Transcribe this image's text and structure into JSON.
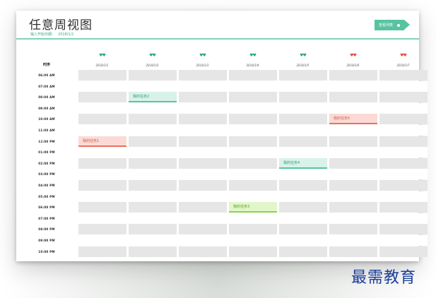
{
  "title": "任意周视图",
  "subtitle": {
    "label": "输入开始日期：",
    "value": "2018/1/1"
  },
  "task_button": {
    "label": "查看列表"
  },
  "time_header": "时序",
  "days": [
    {
      "date": "2018/1/1",
      "hearts": "♥♥",
      "color": "#2fa57a"
    },
    {
      "date": "2018/1/2",
      "hearts": "♥♥",
      "color": "#2fa57a"
    },
    {
      "date": "2018/1/3",
      "hearts": "♥♥",
      "color": "#2fa57a"
    },
    {
      "date": "2018/1/4",
      "hearts": "♥♥",
      "color": "#2fa57a"
    },
    {
      "date": "2018/1/5",
      "hearts": "♥♥",
      "color": "#2fa57a"
    },
    {
      "date": "2018/1/6",
      "hearts": "♥♥",
      "color": "#e24a3c"
    },
    {
      "date": "2018/1/7",
      "hearts": "♥♥",
      "color": "#e24a3c"
    }
  ],
  "times": [
    "06:00 AM",
    "07:00 AM",
    "08:00 AM",
    "09:00 AM",
    "10:00 AM",
    "11:00 AM",
    "12:00 PM",
    "01:00 PM",
    "02:00 PM",
    "03:00 PM",
    "04:00 PM",
    "05:00 PM",
    "06:00 PM",
    "07:00 PM",
    "08:00 PM",
    "09:00 PM",
    "10:00 PM"
  ],
  "tasks": [
    {
      "label": "我的任务1",
      "day": 0,
      "time": 6,
      "style": "red"
    },
    {
      "label": "我的任务2",
      "day": 1,
      "time": 2,
      "style": "teal"
    },
    {
      "label": "我的任务3",
      "day": 3,
      "time": 12,
      "style": "green"
    },
    {
      "label": "我的任务4",
      "day": 4,
      "time": 8,
      "style": "teal"
    },
    {
      "label": "我的任务5",
      "day": 5,
      "time": 4,
      "style": "red"
    }
  ],
  "watermark": "最需教育",
  "colors": {
    "accent": "#58c3a1",
    "header_line": "#7fd3b6",
    "cell": "#e6e6e6"
  }
}
